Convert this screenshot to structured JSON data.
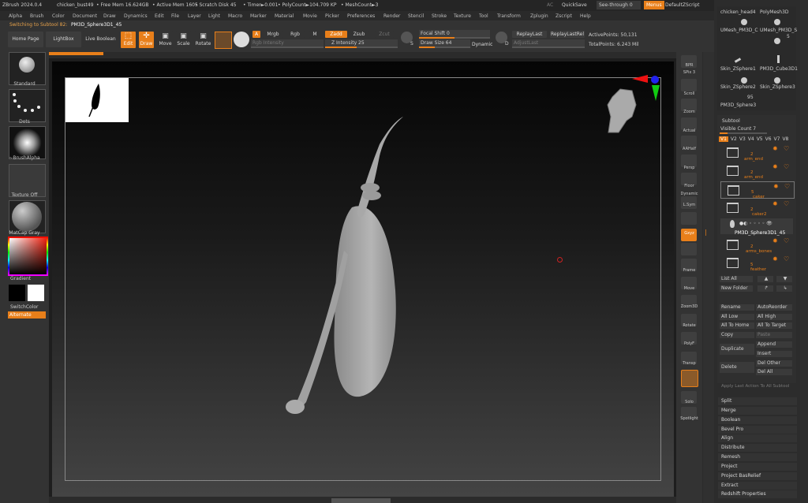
{
  "titlebar": {
    "app": "ZBrush 2024.0.4",
    "file": "chicken_bust49",
    "free_mem": "• Free Mem 16.624GB",
    "active_mem": "• Active Mem 1605",
    "scratch": "• Scratch Disk 45",
    "timer": "• Timer►0.001",
    "polycount": "• PolyCount►104.709 KP",
    "meshcount": "• MeshCount►3",
    "ac": "AC",
    "quicksave": "QuickSave",
    "seethrough": "See-through  0",
    "menus": "Menus",
    "script": "DefaultZScript"
  },
  "menu": [
    "Alpha",
    "Brush",
    "Color",
    "Document",
    "Draw",
    "Dynamics",
    "Edit",
    "File",
    "Layer",
    "Light",
    "Macro",
    "Marker",
    "Material",
    "Movie",
    "Picker",
    "Preferences",
    "Render",
    "Stencil",
    "Stroke",
    "Texture",
    "Tool",
    "Transform",
    "Zplugin",
    "Zscript",
    "Help"
  ],
  "notice": "Switching to Subtool 82:",
  "notice_tool": "PM3D_Sphere3D1_45",
  "top": {
    "home": "Home Page",
    "lightbox": "LightBox",
    "liveboolean": "Live Boolean",
    "edit": "Edit",
    "draw": "Draw",
    "move": "Move",
    "scale": "Scale",
    "rotate": "Rotate",
    "a": "A",
    "mrgb": "Mrgb",
    "rgb": "Rgb",
    "m": "M",
    "zadd": "Zadd",
    "zsub": "Zsub",
    "zcut": "Zcut",
    "rgb_intensity": "Rgb Intensity",
    "z_intensity": "Z Intensity 25",
    "focal_shift": "Focal Shift 0",
    "draw_size": "Draw Size 64",
    "dynamic": "Dynamic",
    "replaylast": "ReplayLast",
    "replaylastrel": "ReplayLastRel",
    "adjustlast": "AdjustLast",
    "active_points": "ActivePoints: 50,131",
    "total_points": "TotalPoints: 6.243 Mil",
    "s": "S",
    "d": "D"
  },
  "left": {
    "standard": "Standard",
    "dots": "Dots",
    "brushalpha": "~BrushAlpha",
    "textureoff": "Texture Off",
    "matcap": "MatCap Gray",
    "gradient": "Gradient",
    "switchcolor": "SwitchColor",
    "alternate": "Alternate"
  },
  "right": [
    "BPR",
    "SPix 3",
    "Scroll",
    "Zoom",
    "Actual",
    "AAHalf",
    "Persp",
    "Floor",
    "Dynamic",
    "L.Sym",
    "Gxyz",
    "",
    "Frame",
    "Move",
    "Zoom3D",
    "Rotate",
    "PolyF",
    "Transp",
    "",
    "Solo",
    "Spotlight"
  ],
  "panel": {
    "tools": [
      "chicken_head4",
      "PolyMesh3D",
      "UMesh_PM3D_C",
      "UMesh_PM3D_S",
      "Skin_ZSphere1",
      "PM3D_Cube3D1",
      "Skin_ZSphere2",
      "Skin_ZSphere3",
      "PM3D_Sphere3"
    ],
    "tool_count": "95",
    "tool_count2": "5",
    "subtool": "Subtool",
    "visible_count": "Visible Count  7",
    "versions": [
      "V1",
      "V2",
      "V3",
      "V4",
      "V5",
      "V6",
      "V7",
      "V8"
    ],
    "subtools": [
      "arm_end",
      "arm_end",
      "caker",
      "caker2",
      "PM3D_Sphere3D1_45",
      "arms_bones",
      "feather"
    ],
    "subtools_num": [
      "2",
      "2",
      "5",
      "2",
      "",
      "2",
      "5"
    ],
    "listall": "List All",
    "newfolder": "New Folder",
    "rename": "Rename",
    "autoreorder": "AutoReorder",
    "alllow": "All Low",
    "allhigh": "All High",
    "alltohome": "All To Home",
    "alltotarget": "All To Target",
    "copy": "Copy",
    "paste": "Paste",
    "duplicate": "Duplicate",
    "append": "Append",
    "insert": "Insert",
    "delete": "Delete",
    "delother": "Del Other",
    "delall": "Del All",
    "applylast": "Apply Last Action To All Subtool",
    "menus": [
      "Split",
      "Merge",
      "Boolean",
      "Bevel Pro",
      "Align",
      "Distribute",
      "Remesh",
      "Project",
      "Project BasRelief",
      "Extract",
      "Redshift Properties"
    ]
  }
}
